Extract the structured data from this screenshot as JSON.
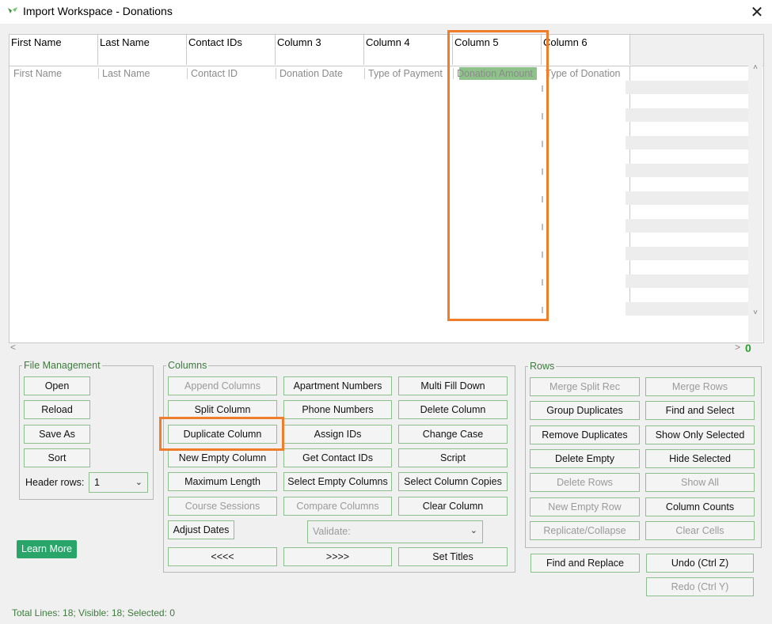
{
  "window": {
    "title": "Import Workspace - Donations",
    "close_glyph": "✕"
  },
  "grid": {
    "headers": [
      "First Name",
      "Last Name",
      "Contact IDs",
      "Column 3",
      "Column 4",
      "Column 5",
      "Column 6"
    ],
    "mapped_fields": [
      "First Name",
      "Last Name",
      "Contact ID",
      "Donation Date",
      "Type of Payment",
      "Donation Amount",
      "Type of Donation"
    ],
    "selected_column": "Column 5",
    "selected_color": "#8fc28a"
  },
  "scroll": {
    "left": "<",
    "right": ">",
    "up": "˄",
    "down": "˅",
    "indicator": "0"
  },
  "file_management": {
    "label": "File Management",
    "open": "Open",
    "reload": "Reload",
    "save_as": "Save As",
    "sort": "Sort",
    "header_rows_label": "Header rows:",
    "header_rows_value": "1"
  },
  "columns": {
    "label": "Columns",
    "append_columns": "Append Columns",
    "apartment_numbers": "Apartment Numbers",
    "multi_fill_down": "Multi Fill Down",
    "split_column": "Split Column",
    "phone_numbers": "Phone Numbers",
    "delete_column": "Delete Column",
    "duplicate_column": "Duplicate Column",
    "assign_ids": "Assign IDs",
    "change_case": "Change Case",
    "new_empty_column": "New Empty Column",
    "get_contact_ids": "Get Contact IDs",
    "script": "Script",
    "maximum_length": "Maximum Length",
    "select_empty_columns": "Select Empty Columns",
    "select_column_copies": "Select Column Copies",
    "course_sessions": "Course Sessions",
    "compare_columns": "Compare Columns",
    "clear_column": "Clear Column",
    "adjust_dates": "Adjust Dates",
    "validate_placeholder": "Validate:",
    "prev": "<<<<",
    "next": ">>>>",
    "set_titles": "Set Titles"
  },
  "rows": {
    "label": "Rows",
    "merge_split_rec": "Merge Split Rec",
    "merge_rows": "Merge Rows",
    "group_duplicates": "Group Duplicates",
    "find_and_select": "Find and Select",
    "remove_duplicates": "Remove Duplicates",
    "show_only_selected": "Show Only Selected",
    "delete_empty": "Delete Empty",
    "hide_selected": "Hide Selected",
    "delete_rows": "Delete Rows",
    "show_all": "Show All",
    "new_empty_row": "New Empty Row",
    "column_counts": "Column Counts",
    "replicate_collapse": "Replicate/Collapse",
    "clear_cells": "Clear Cells"
  },
  "bottom": {
    "find_and_replace": "Find and Replace",
    "undo": "Undo (Ctrl Z)",
    "redo": "Redo (Ctrl Y)",
    "learn_more": "Learn More"
  },
  "status": "Total Lines: 18; Visible: 18; Selected: 0",
  "colors": {
    "accent_orange": "#f07d2c",
    "brand_green": "#2aa56a",
    "label_green": "#3d7a3d"
  }
}
